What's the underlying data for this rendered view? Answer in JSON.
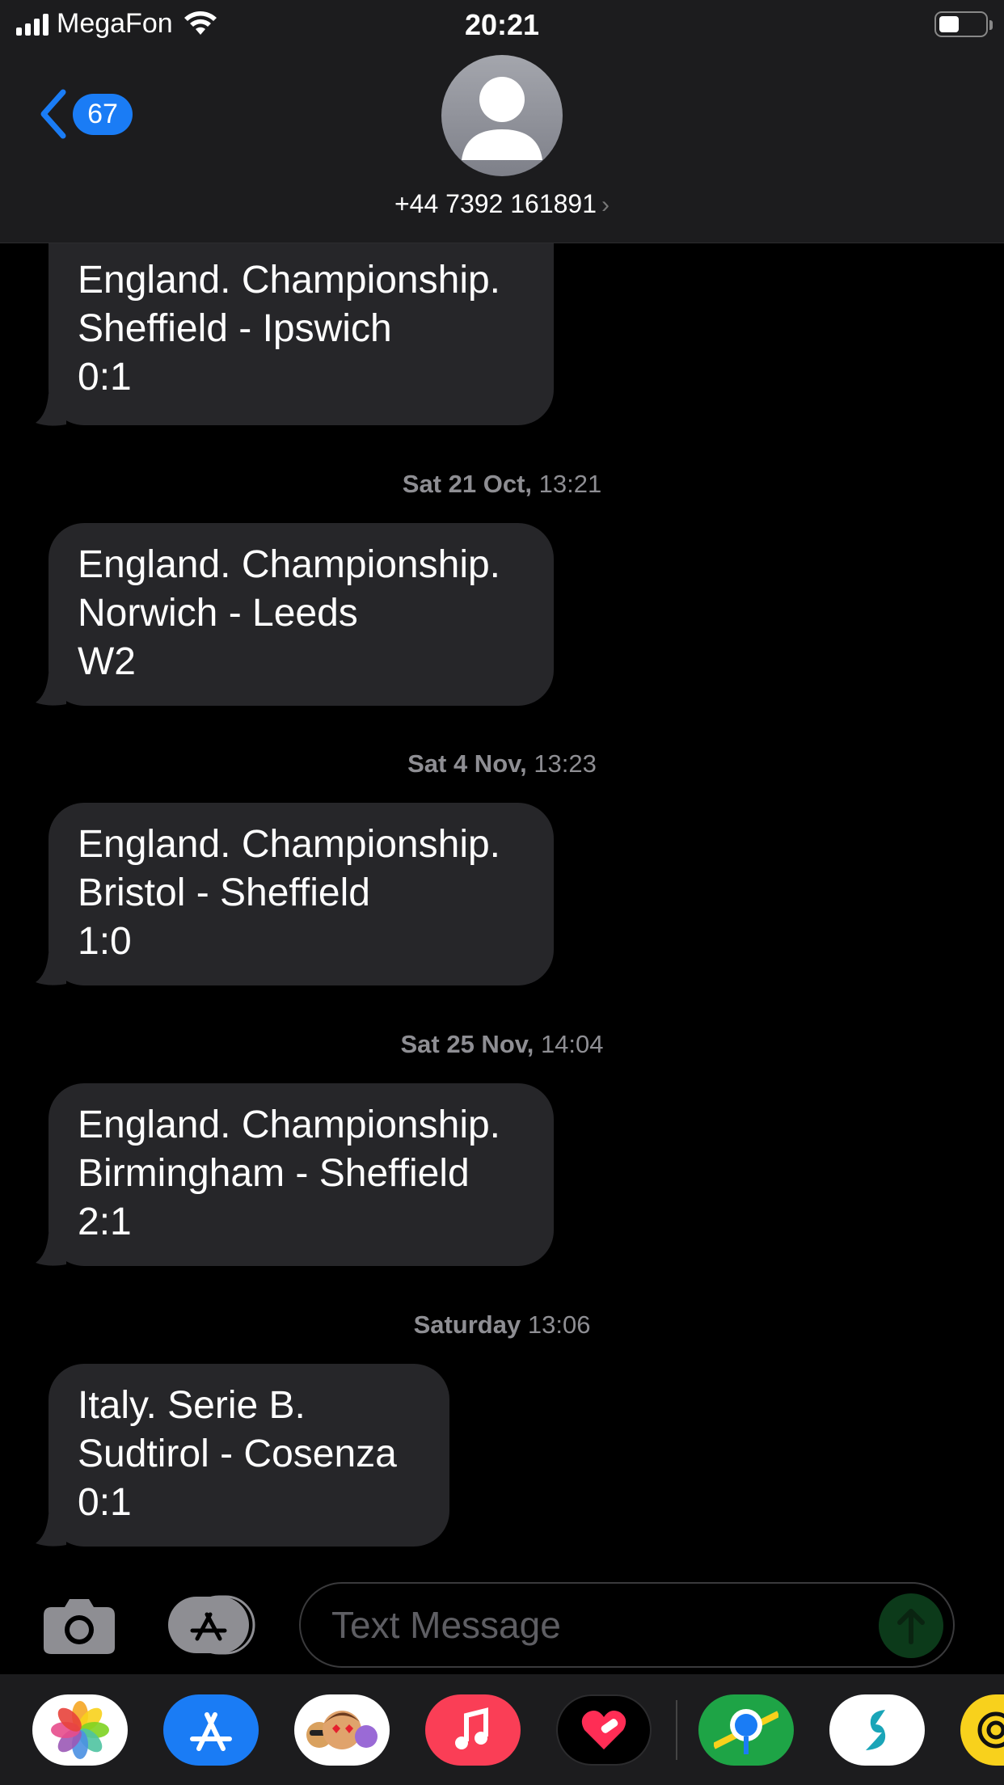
{
  "status_bar": {
    "carrier": "MegaFon",
    "time": "20:21"
  },
  "header": {
    "back_count": "67",
    "contact_name": "+44 7392 161891"
  },
  "messages": [
    {
      "lines": [
        "England. Championship.",
        "Sheffield - Ipswich",
        "0:1"
      ]
    },
    {
      "timestamp_day": "Sat 21 Oct,",
      "timestamp_time": "13:21",
      "lines": [
        "England. Championship.",
        "Norwich - Leeds",
        "W2"
      ]
    },
    {
      "timestamp_day": "Sat 4 Nov,",
      "timestamp_time": "13:23",
      "lines": [
        "England. Championship.",
        "Bristol - Sheffield",
        "1:0"
      ]
    },
    {
      "timestamp_day": "Sat 25 Nov,",
      "timestamp_time": "14:04",
      "lines": [
        "England. Championship.",
        "Birmingham - Sheffield",
        "2:1"
      ]
    },
    {
      "timestamp_day": "Saturday",
      "timestamp_time": "13:06",
      "lines": [
        "Italy. Serie B.",
        "Sudtirol - Cosenza",
        "0:1"
      ]
    }
  ],
  "composer": {
    "placeholder": "Text Message"
  },
  "dock_apps": [
    "photos-app-icon",
    "app-store-app-icon",
    "memoji-app-icon",
    "music-app-icon",
    "heart-app-icon",
    "maps-app-icon",
    "surfshark-app-icon",
    "yellow-app-icon"
  ],
  "colors": {
    "accent": "#1a7cf5",
    "bubble": "#262629",
    "header_bg": "#1c1c1e",
    "timestamp": "#8e8e93"
  }
}
